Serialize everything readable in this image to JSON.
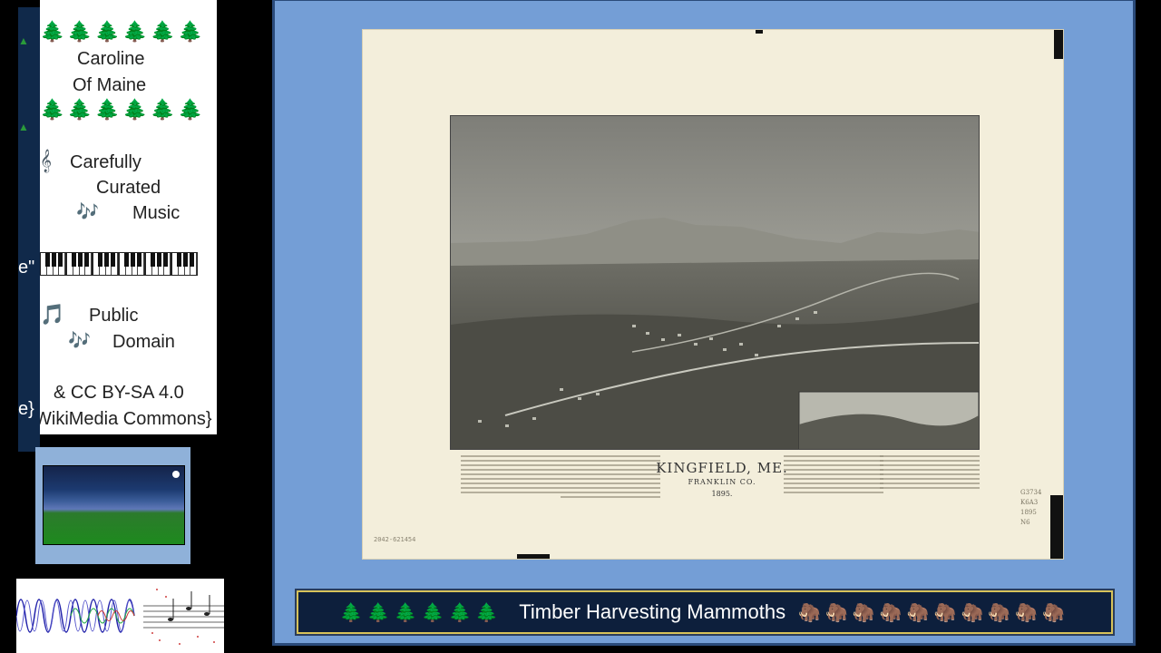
{
  "left_panel": {
    "tree_row": "🌲🌲🌲🌲🌲🌲",
    "name_line1": "Caroline",
    "name_line2": "Of Maine",
    "clef_icon": "𝄞",
    "curated_1": "Carefully",
    "curated_2": "Curated",
    "notes_icon": "🎶",
    "curated_3": "Music",
    "note_icon": "🎵",
    "public": "Public",
    "domain": "Domain",
    "license": "&  CC BY-SA 4.0",
    "source": "WikiMedia Commons}",
    "behind_fragments": {
      "quote": "e\"",
      "brace": "e}"
    }
  },
  "map": {
    "title": "KINGFIELD, ME.",
    "county": "FRANKLIN CO.",
    "year": "1895.",
    "catalog_number": "2042-621454",
    "call_number": [
      "G3734",
      "K6A3",
      "1895",
      "N6"
    ]
  },
  "banner": {
    "trees": "🌲🌲🌲🌲🌲🌲",
    "title": "Timber Harvesting Mammoths",
    "mammoths": "🦣🦣🦣🦣🦣🦣🦣🦣🦣🦣"
  },
  "colors": {
    "frame_blue": "#749ed6",
    "banner_navy": "#0d1f3c",
    "banner_border": "#d6c25a",
    "tree_green": "#1e8a32"
  }
}
